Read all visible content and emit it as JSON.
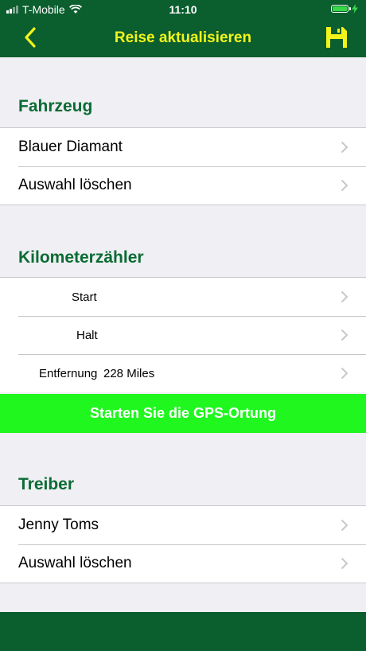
{
  "status": {
    "carrier": "T-Mobile",
    "time": "11:10"
  },
  "nav": {
    "title": "Reise aktualisieren",
    "back_icon": "chevron-left-icon",
    "save_icon": "floppy-disk-icon"
  },
  "colors": {
    "brand_green": "#0b5e2e",
    "title_yellow": "#f2f51a",
    "section_green": "#0b6b33",
    "gps_button": "#1ff71f"
  },
  "vehicle": {
    "header": "Fahrzeug",
    "selected": "Blauer Diamant",
    "clear": "Auswahl löschen"
  },
  "odometer": {
    "header": "Kilometerzähler",
    "start_label": "Start",
    "stop_label": "Halt",
    "distance_label": "Entfernung",
    "distance_value": "228 Miles"
  },
  "gps": {
    "button_label": "Starten Sie die GPS-Ortung"
  },
  "driver": {
    "header": "Treiber",
    "selected": "Jenny Toms",
    "clear": "Auswahl löschen"
  }
}
